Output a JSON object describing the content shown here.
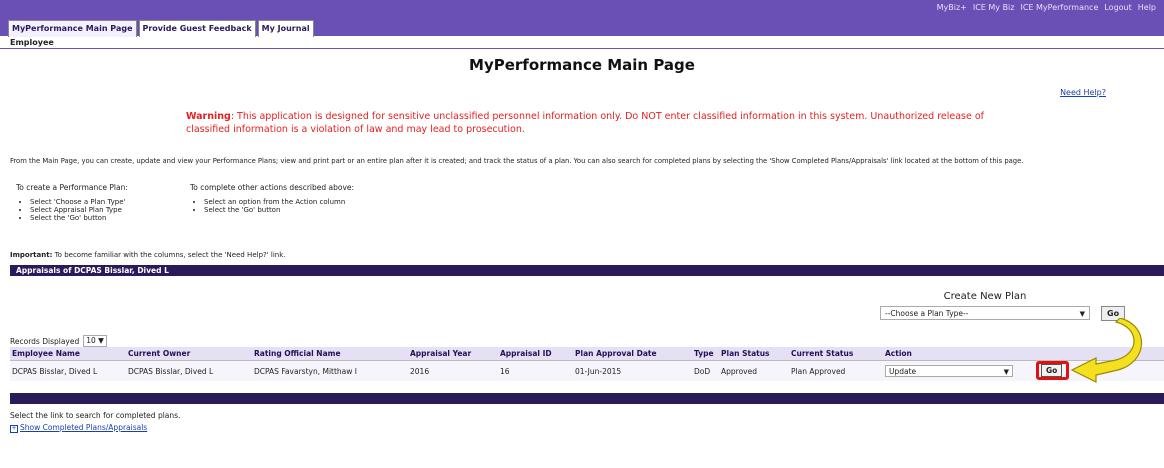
{
  "header": {
    "top_links": [
      "MyBiz+",
      "ICE My Biz",
      "ICE MyPerformance",
      "Logout",
      "Help"
    ],
    "tabs": [
      "MyPerformance Main Page",
      "Provide Guest Feedback",
      "My Journal"
    ],
    "subnav": "Employee"
  },
  "main": {
    "title": "MyPerformance Main Page",
    "need_help": "Need Help?",
    "warning_label": "Warning",
    "warning_text": ": This application is designed for sensitive unclassified personnel information only. Do NOT enter classified information in this system. Unauthorized release of classified information is a violation of law and may lead to prosecution.",
    "description": "From the Main Page, you can create, update and view your Performance Plans; view and print part or an entire plan after it is created; and track the status of a plan. You can also search for completed plans by selecting the 'Show Completed Plans/Appraisals' link located at the bottom of this page.",
    "create_heading": "To create a Performance Plan:",
    "create_steps": [
      "Select 'Choose a Plan Type'",
      "Select Appraisal Plan Type",
      "Select the 'Go' button"
    ],
    "other_heading": "To complete other actions described above:",
    "other_steps": [
      "Select an option from the Action column",
      "Select the 'Go' button"
    ],
    "important_label": "Important:",
    "important_text": " To become familiar with the columns, select the 'Need Help?' link."
  },
  "section": {
    "title": "Appraisals of DCPAS Bisslar, Dived L",
    "create_new_plan": "Create New Plan",
    "plan_type_placeholder": "--Choose a Plan Type--",
    "go_label": "Go",
    "records_label": "Records Displayed",
    "records_value": "10"
  },
  "table": {
    "columns": [
      "Employee Name",
      "Current Owner",
      "Rating Official Name",
      "Appraisal Year",
      "Appraisal ID",
      "Plan Approval Date",
      "Type",
      "Plan Status",
      "Current Status",
      "Action"
    ],
    "rows": [
      {
        "employee": "DCPAS Bisslar, Dived L",
        "owner": "DCPAS Bisslar, Dived L",
        "rating_official": "DCPAS Favarstyn, Mitthaw I",
        "year": "2016",
        "id": "16",
        "approval_date": "01-Jun-2015",
        "type": "DoD",
        "plan_status": "Approved",
        "current_status": "Plan Approved",
        "action": "Update",
        "go": "Go"
      }
    ]
  },
  "footer": {
    "search_text": "Select the link to search for completed plans.",
    "show_completed": "Show Completed Plans/Appraisals"
  },
  "colors": {
    "header_purple": "#6a4fb5",
    "section_dark": "#2b1a5a",
    "warning_red": "#e62020",
    "highlight_red": "#e21010",
    "arrow_yellow": "#f5e020"
  }
}
